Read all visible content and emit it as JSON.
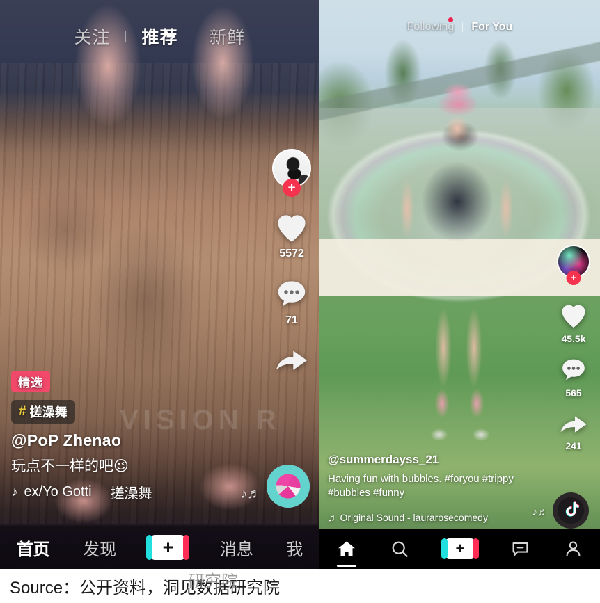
{
  "figure": {
    "source_label": "Source：公开资料，洞见数据研究院",
    "source_overlap_text": "研究院"
  },
  "douyin": {
    "app": "Douyin",
    "watermark": "VISION R",
    "top_tabs": [
      {
        "label": "关注",
        "active": false
      },
      {
        "label": "推荐",
        "active": true
      },
      {
        "label": "新鲜",
        "active": false
      }
    ],
    "rail": {
      "avatar_name": "creator-avatar",
      "follow_plus": "+",
      "like_count": "5572",
      "comment_count": "71",
      "share_icon": "share-arrow-icon"
    },
    "caption": {
      "featured_badge": "精选",
      "hashtag_hash": "#",
      "hashtag_label": "搓澡舞",
      "username": "@PoP Zhenao",
      "description": "玩点不一样的吧😉",
      "music_note": "♪",
      "music_title": "ex/Yo Gotti",
      "music_extra": "搓澡舞"
    },
    "bottom_nav": [
      {
        "label": "首页",
        "active": true
      },
      {
        "label": "发现",
        "active": false
      },
      {
        "label": "+",
        "active": false
      },
      {
        "label": "消息",
        "active": false
      },
      {
        "label": "我",
        "active": false
      }
    ]
  },
  "tiktok": {
    "app": "TikTok",
    "top_tabs": [
      {
        "label": "Following",
        "active": false,
        "has_dot": true
      },
      {
        "label": "For You",
        "active": true,
        "has_dot": false
      }
    ],
    "rail": {
      "avatar_name": "creator-avatar",
      "follow_plus": "+",
      "like_count": "45.5k",
      "comment_count": "565",
      "share_count": "241"
    },
    "caption": {
      "username": "@summerdayss_21",
      "description": "Having fun with bubbles. #foryou #trippy #bubbles #funny",
      "music_note": "♫",
      "music_title": "Original Sound - laurarosecomedy"
    },
    "bottom_nav": [
      {
        "icon": "home-icon",
        "active": true
      },
      {
        "icon": "search-icon",
        "active": false
      },
      {
        "icon": "create-plus-icon",
        "active": false
      },
      {
        "icon": "inbox-icon",
        "active": false
      },
      {
        "icon": "profile-icon",
        "active": false
      }
    ]
  },
  "colors": {
    "accent_red": "#f5334f",
    "featured_badge": "#f2496b",
    "hashtag_yellow": "#f4d03f",
    "tiktok_cyan": "#22dfe0",
    "tiktok_pink": "#ff2d55",
    "dot_badge": "#ef2350"
  }
}
